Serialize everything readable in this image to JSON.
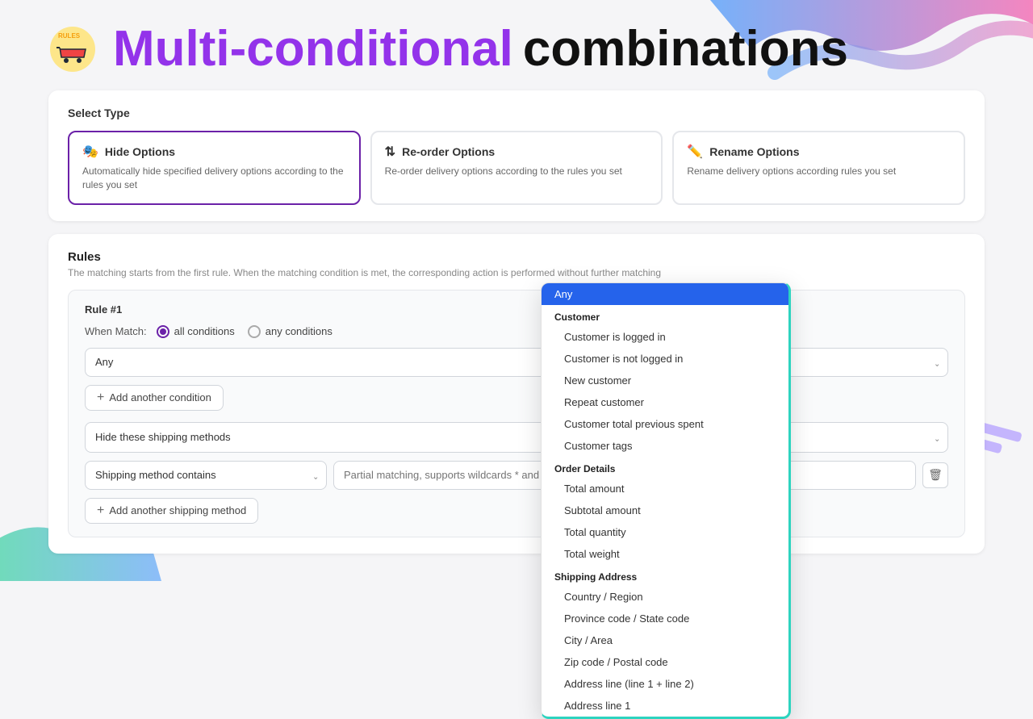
{
  "header": {
    "title_purple": "Multi-conditional",
    "title_black": "combinations"
  },
  "select_type": {
    "label": "Select Type",
    "options": [
      {
        "icon": "🎭",
        "label": "Hide Options",
        "desc": "Automatically hide specified delivery options according to the rules you set",
        "selected": true
      },
      {
        "icon": "⇅",
        "label": "Re-order Options",
        "desc": "Re-order delivery options according to the rules you set",
        "selected": false
      },
      {
        "icon": "✏️",
        "label": "Rename Options",
        "desc": "Rename delivery options according rules you set",
        "selected": false
      }
    ]
  },
  "rules": {
    "title": "Rules",
    "description": "The matching starts from the first rule. When the matching condition is met, the corresponding action is performed without further matching",
    "rule_number": "Rule #1",
    "when_match_label": "When Match:",
    "radio_all": "all conditions",
    "radio_any": "any conditions",
    "condition_value": "Any",
    "add_condition_label": "Add another condition",
    "shipping_select_label": "Hide these shipping methods",
    "shipping_method_select_label": "Shipping method contains",
    "shipping_method_placeholder": "Partial matching, supports wildcards * and %",
    "add_shipping_label": "Add another shipping method"
  },
  "dropdown": {
    "items": [
      {
        "label": "Any",
        "type": "active",
        "indent": false
      },
      {
        "label": "Customer",
        "type": "group",
        "indent": false
      },
      {
        "label": "Customer is logged in",
        "type": "item",
        "indent": true
      },
      {
        "label": "Customer is not logged in",
        "type": "item",
        "indent": true
      },
      {
        "label": "New customer",
        "type": "item",
        "indent": true
      },
      {
        "label": "Repeat customer",
        "type": "item",
        "indent": true
      },
      {
        "label": "Customer total previous spent",
        "type": "item",
        "indent": true
      },
      {
        "label": "Customer tags",
        "type": "item",
        "indent": true
      },
      {
        "label": "Order Details",
        "type": "group",
        "indent": false
      },
      {
        "label": "Total amount",
        "type": "item",
        "indent": true
      },
      {
        "label": "Subtotal amount",
        "type": "item",
        "indent": true
      },
      {
        "label": "Total quantity",
        "type": "item",
        "indent": true
      },
      {
        "label": "Total weight",
        "type": "item",
        "indent": true
      },
      {
        "label": "Shipping Address",
        "type": "group",
        "indent": false
      },
      {
        "label": "Country / Region",
        "type": "item",
        "indent": true
      },
      {
        "label": "Province code / State code",
        "type": "item",
        "indent": true
      },
      {
        "label": "City / Area",
        "type": "item",
        "indent": true
      },
      {
        "label": "Zip code / Postal code",
        "type": "item",
        "indent": true
      },
      {
        "label": "Address line (line 1 + line 2)",
        "type": "item",
        "indent": true
      },
      {
        "label": "Address line 1",
        "type": "item",
        "indent": true
      }
    ]
  }
}
